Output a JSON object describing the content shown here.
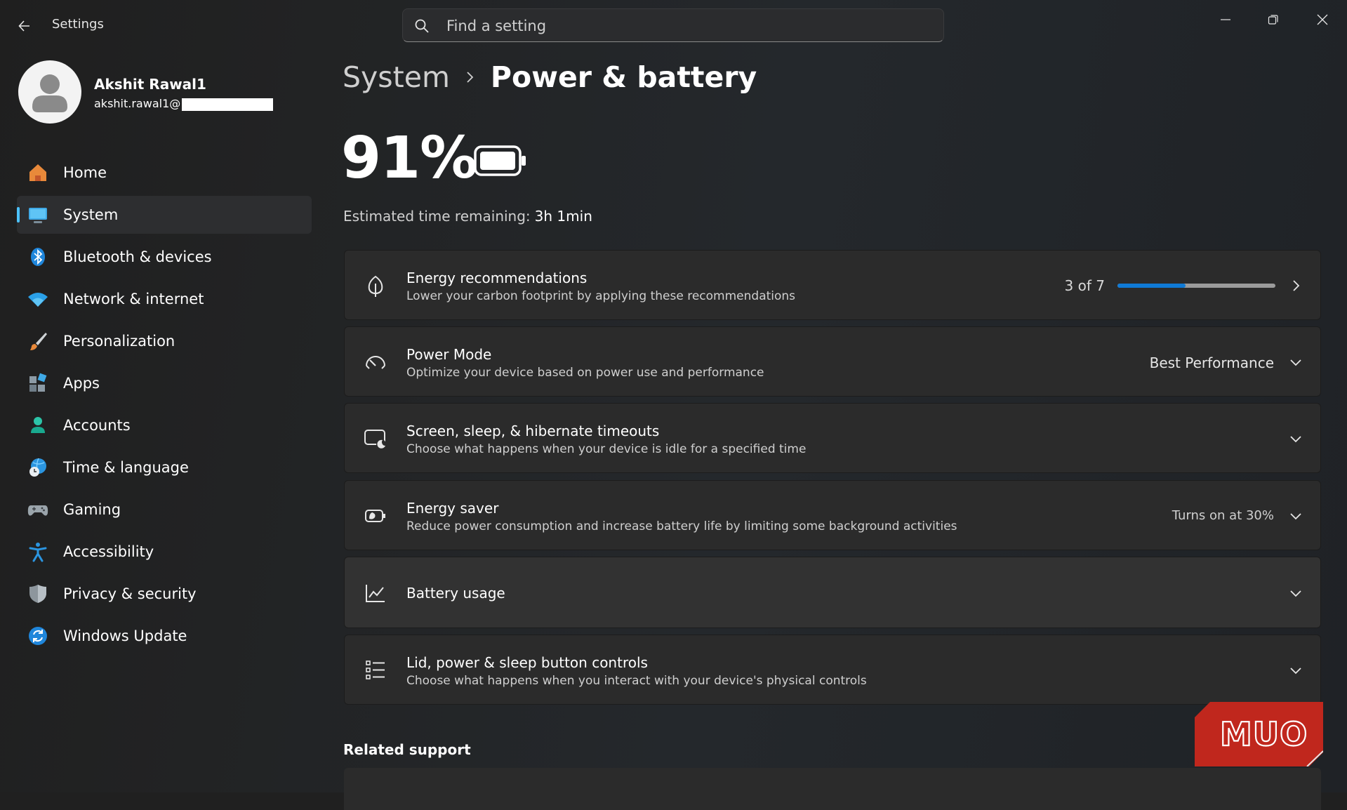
{
  "app": {
    "title": "Settings"
  },
  "search": {
    "placeholder": "Find a setting"
  },
  "user": {
    "name": "Akshit Rawal1",
    "email_prefix": "akshit.rawal1@"
  },
  "sidebar": {
    "items": [
      {
        "label": "Home",
        "icon": "home-icon"
      },
      {
        "label": "System",
        "icon": "system-icon",
        "selected": true
      },
      {
        "label": "Bluetooth & devices",
        "icon": "bluetooth-icon"
      },
      {
        "label": "Network & internet",
        "icon": "wifi-icon"
      },
      {
        "label": "Personalization",
        "icon": "brush-icon"
      },
      {
        "label": "Apps",
        "icon": "apps-icon"
      },
      {
        "label": "Accounts",
        "icon": "accounts-icon"
      },
      {
        "label": "Time & language",
        "icon": "globe-clock-icon"
      },
      {
        "label": "Gaming",
        "icon": "gamepad-icon"
      },
      {
        "label": "Accessibility",
        "icon": "accessibility-icon"
      },
      {
        "label": "Privacy & security",
        "icon": "shield-icon"
      },
      {
        "label": "Windows Update",
        "icon": "update-icon"
      }
    ]
  },
  "breadcrumb": {
    "parent": "System",
    "current": "Power & battery"
  },
  "battery": {
    "percent": "91%",
    "estimate_label": "Estimated time remaining:",
    "estimate_value": "3h 1min"
  },
  "cards": {
    "energy_recommendations": {
      "title": "Energy recommendations",
      "subtitle": "Lower your carbon footprint by applying these recommendations",
      "progress_text": "3 of 7",
      "progress_fraction": 0.43
    },
    "power_mode": {
      "title": "Power Mode",
      "subtitle": "Optimize your device based on power use and performance",
      "value": "Best Performance"
    },
    "screen_sleep": {
      "title": "Screen, sleep, & hibernate timeouts",
      "subtitle": "Choose what happens when your device is idle for a specified time"
    },
    "energy_saver": {
      "title": "Energy saver",
      "subtitle": "Reduce power consumption and increase battery life by limiting some background activities",
      "value": "Turns on at 30%"
    },
    "battery_usage": {
      "title": "Battery usage"
    },
    "lid_power": {
      "title": "Lid, power & sleep button controls",
      "subtitle": "Choose what happens when you interact with your device's physical controls"
    }
  },
  "related_support": {
    "heading": "Related support"
  },
  "watermark": {
    "text": "MUO"
  },
  "colors": {
    "accent": "#4cc2ff",
    "progress": "#0f7ad6",
    "background": "#202020",
    "card": "#2b2b2b",
    "watermark": "#c0271d"
  }
}
